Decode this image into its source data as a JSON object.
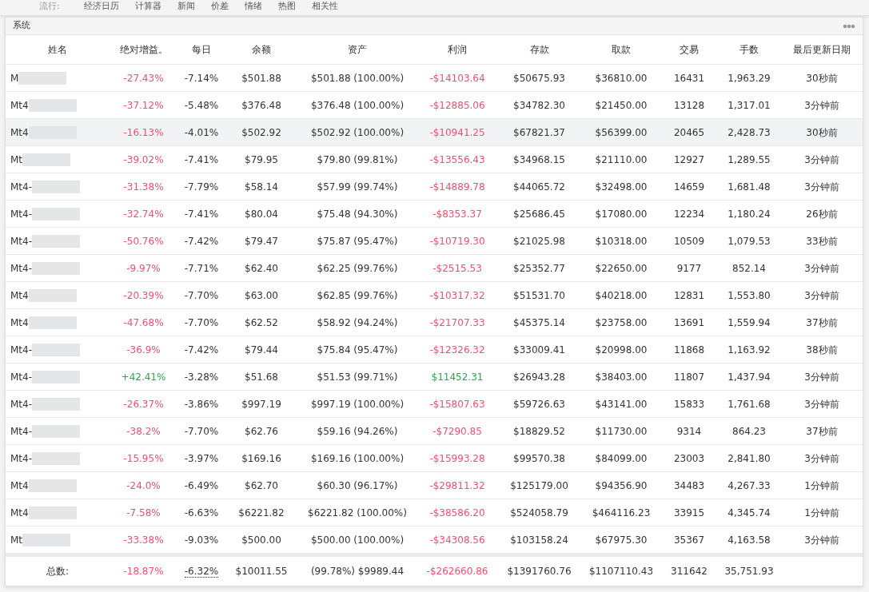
{
  "nav": {
    "label": "流行:",
    "links": [
      "经济日历",
      "计算器",
      "新闻",
      "价差",
      "情绪",
      "热图",
      "相关性"
    ]
  },
  "panel": {
    "title": "系统"
  },
  "table": {
    "columns": [
      "姓名",
      "绝对增益。",
      "每日",
      "余额",
      "资产",
      "利润",
      "存款",
      "取款",
      "交易",
      "手数",
      "最后更新日期"
    ],
    "rows": [
      {
        "name": "M",
        "gain": "-27.43%",
        "daily": "-7.14%",
        "balance": "$501.88",
        "equity": "$501.88 (100.00%)",
        "profit": "-$14103.64",
        "deposit": "$50675.93",
        "withdraw": "$36810.00",
        "trades": "16431",
        "lots": "1,963.29",
        "updated": "30秒前",
        "color": "#f0506e",
        "highlighted": false
      },
      {
        "name": "Mt4",
        "gain": "-37.12%",
        "daily": "-5.48%",
        "balance": "$376.48",
        "equity": "$376.48 (100.00%)",
        "profit": "-$12885.06",
        "deposit": "$34782.30",
        "withdraw": "$21450.00",
        "trades": "13128",
        "lots": "1,317.01",
        "updated": "3分钟前",
        "color": "#f0506e",
        "highlighted": false
      },
      {
        "name": "Mt4",
        "gain": "-16.13%",
        "daily": "-4.01%",
        "balance": "$502.92",
        "equity": "$502.92 (100.00%)",
        "profit": "-$10941.25",
        "deposit": "$67821.37",
        "withdraw": "$56399.00",
        "trades": "20465",
        "lots": "2,428.73",
        "updated": "30秒前",
        "color": "#f0506e",
        "highlighted": true
      },
      {
        "name": "Mt",
        "gain": "-39.02%",
        "daily": "-7.41%",
        "balance": "$79.95",
        "equity": "$79.80 (99.81%)",
        "profit": "-$13556.43",
        "deposit": "$34968.15",
        "withdraw": "$21110.00",
        "trades": "12927",
        "lots": "1,289.55",
        "updated": "3分钟前",
        "color": "#f0506e",
        "highlighted": false
      },
      {
        "name": "Mt4-",
        "gain": "-31.38%",
        "daily": "-7.79%",
        "balance": "$58.14",
        "equity": "$57.99 (99.74%)",
        "profit": "-$14889.78",
        "deposit": "$44065.72",
        "withdraw": "$32498.00",
        "trades": "14659",
        "lots": "1,681.48",
        "updated": "3分钟前",
        "color": "#f0506e",
        "highlighted": false
      },
      {
        "name": "Mt4-",
        "gain": "-32.74%",
        "daily": "-7.41%",
        "balance": "$80.04",
        "equity": "$75.48 (94.30%)",
        "profit": "-$8353.37",
        "deposit": "$25686.45",
        "withdraw": "$17080.00",
        "trades": "12234",
        "lots": "1,180.24",
        "updated": "26秒前",
        "color": "#f0506e",
        "highlighted": false
      },
      {
        "name": "Mt4-",
        "gain": "-50.76%",
        "daily": "-7.42%",
        "balance": "$79.47",
        "equity": "$75.87 (95.47%)",
        "profit": "-$10719.30",
        "deposit": "$21025.98",
        "withdraw": "$10318.00",
        "trades": "10509",
        "lots": "1,079.53",
        "updated": "33秒前",
        "color": "#f0506e",
        "highlighted": false
      },
      {
        "name": "Mt4-",
        "gain": "-9.97%",
        "daily": "-7.71%",
        "balance": "$62.40",
        "equity": "$62.25 (99.76%)",
        "profit": "-$2515.53",
        "deposit": "$25352.77",
        "withdraw": "$22650.00",
        "trades": "9177",
        "lots": "852.14",
        "updated": "3分钟前",
        "color": "#f0506e",
        "highlighted": false
      },
      {
        "name": "Mt4",
        "gain": "-20.39%",
        "daily": "-7.70%",
        "balance": "$63.00",
        "equity": "$62.85 (99.76%)",
        "profit": "-$10317.32",
        "deposit": "$51531.70",
        "withdraw": "$40218.00",
        "trades": "12831",
        "lots": "1,553.80",
        "updated": "3分钟前",
        "color": "#f0506e",
        "highlighted": false
      },
      {
        "name": "Mt4",
        "gain": "-47.68%",
        "daily": "-7.70%",
        "balance": "$62.52",
        "equity": "$58.92 (94.24%)",
        "profit": "-$21707.33",
        "deposit": "$45375.14",
        "withdraw": "$23758.00",
        "trades": "13691",
        "lots": "1,559.94",
        "updated": "37秒前",
        "color": "#f0506e",
        "highlighted": false
      },
      {
        "name": "Mt4-",
        "gain": "-36.9%",
        "daily": "-7.42%",
        "balance": "$79.44",
        "equity": "$75.84 (95.47%)",
        "profit": "-$12326.32",
        "deposit": "$33009.41",
        "withdraw": "$20998.00",
        "trades": "11868",
        "lots": "1,163.92",
        "updated": "38秒前",
        "color": "#f0506e",
        "highlighted": false
      },
      {
        "name": "Mt4-",
        "gain": "+42.41%",
        "daily": "-3.28%",
        "balance": "$51.68",
        "equity": "$51.53 (99.71%)",
        "profit": "$11452.31",
        "deposit": "$26943.28",
        "withdraw": "$38403.00",
        "trades": "11807",
        "lots": "1,437.94",
        "updated": "3分钟前",
        "color": "#2ea44f",
        "highlighted": false
      },
      {
        "name": "Mt4-",
        "gain": "-26.37%",
        "daily": "-3.86%",
        "balance": "$997.19",
        "equity": "$997.19 (100.00%)",
        "profit": "-$15807.63",
        "deposit": "$59726.63",
        "withdraw": "$43141.00",
        "trades": "15833",
        "lots": "1,761.68",
        "updated": "3分钟前",
        "color": "#f0506e",
        "highlighted": false
      },
      {
        "name": "Mt4-",
        "gain": "-38.2%",
        "daily": "-7.70%",
        "balance": "$62.76",
        "equity": "$59.16 (94.26%)",
        "profit": "-$7290.85",
        "deposit": "$18829.52",
        "withdraw": "$11730.00",
        "trades": "9314",
        "lots": "864.23",
        "updated": "37秒前",
        "color": "#f0506e",
        "highlighted": false
      },
      {
        "name": "Mt4-",
        "gain": "-15.95%",
        "daily": "-3.97%",
        "balance": "$169.16",
        "equity": "$169.16 (100.00%)",
        "profit": "-$15993.28",
        "deposit": "$99570.38",
        "withdraw": "$84099.00",
        "trades": "23003",
        "lots": "2,841.80",
        "updated": "3分钟前",
        "color": "#f0506e",
        "highlighted": false
      },
      {
        "name": "Mt4",
        "gain": "-24.0%",
        "daily": "-6.49%",
        "balance": "$62.70",
        "equity": "$60.30 (96.17%)",
        "profit": "-$29811.32",
        "deposit": "$125179.00",
        "withdraw": "$94356.90",
        "trades": "34483",
        "lots": "4,267.33",
        "updated": "1分钟前",
        "color": "#f0506e",
        "highlighted": false
      },
      {
        "name": "Mt4",
        "gain": "-7.58%",
        "daily": "-6.63%",
        "balance": "$6221.82",
        "equity": "$6221.82 (100.00%)",
        "profit": "-$38586.20",
        "deposit": "$524058.79",
        "withdraw": "$464116.23",
        "trades": "33915",
        "lots": "4,345.74",
        "updated": "1分钟前",
        "color": "#f0506e",
        "highlighted": false
      },
      {
        "name": "Mt",
        "gain": "-33.38%",
        "daily": "-9.03%",
        "balance": "$500.00",
        "equity": "$500.00 (100.00%)",
        "profit": "-$34308.56",
        "deposit": "$103158.24",
        "withdraw": "$67975.30",
        "trades": "35367",
        "lots": "4,163.58",
        "updated": "3分钟前",
        "color": "#f0506e",
        "highlighted": false
      }
    ],
    "total": {
      "name": "总数:",
      "gain": "-18.87%",
      "daily": "-6.32%",
      "balance": "$10011.55",
      "equity": "(99.78%) $9989.44",
      "profit": "-$262660.86",
      "deposit": "$1391760.76",
      "withdraw": "$1107110.43",
      "trades": "311642",
      "lots": "35,751.93",
      "color": "#f0506e"
    }
  }
}
